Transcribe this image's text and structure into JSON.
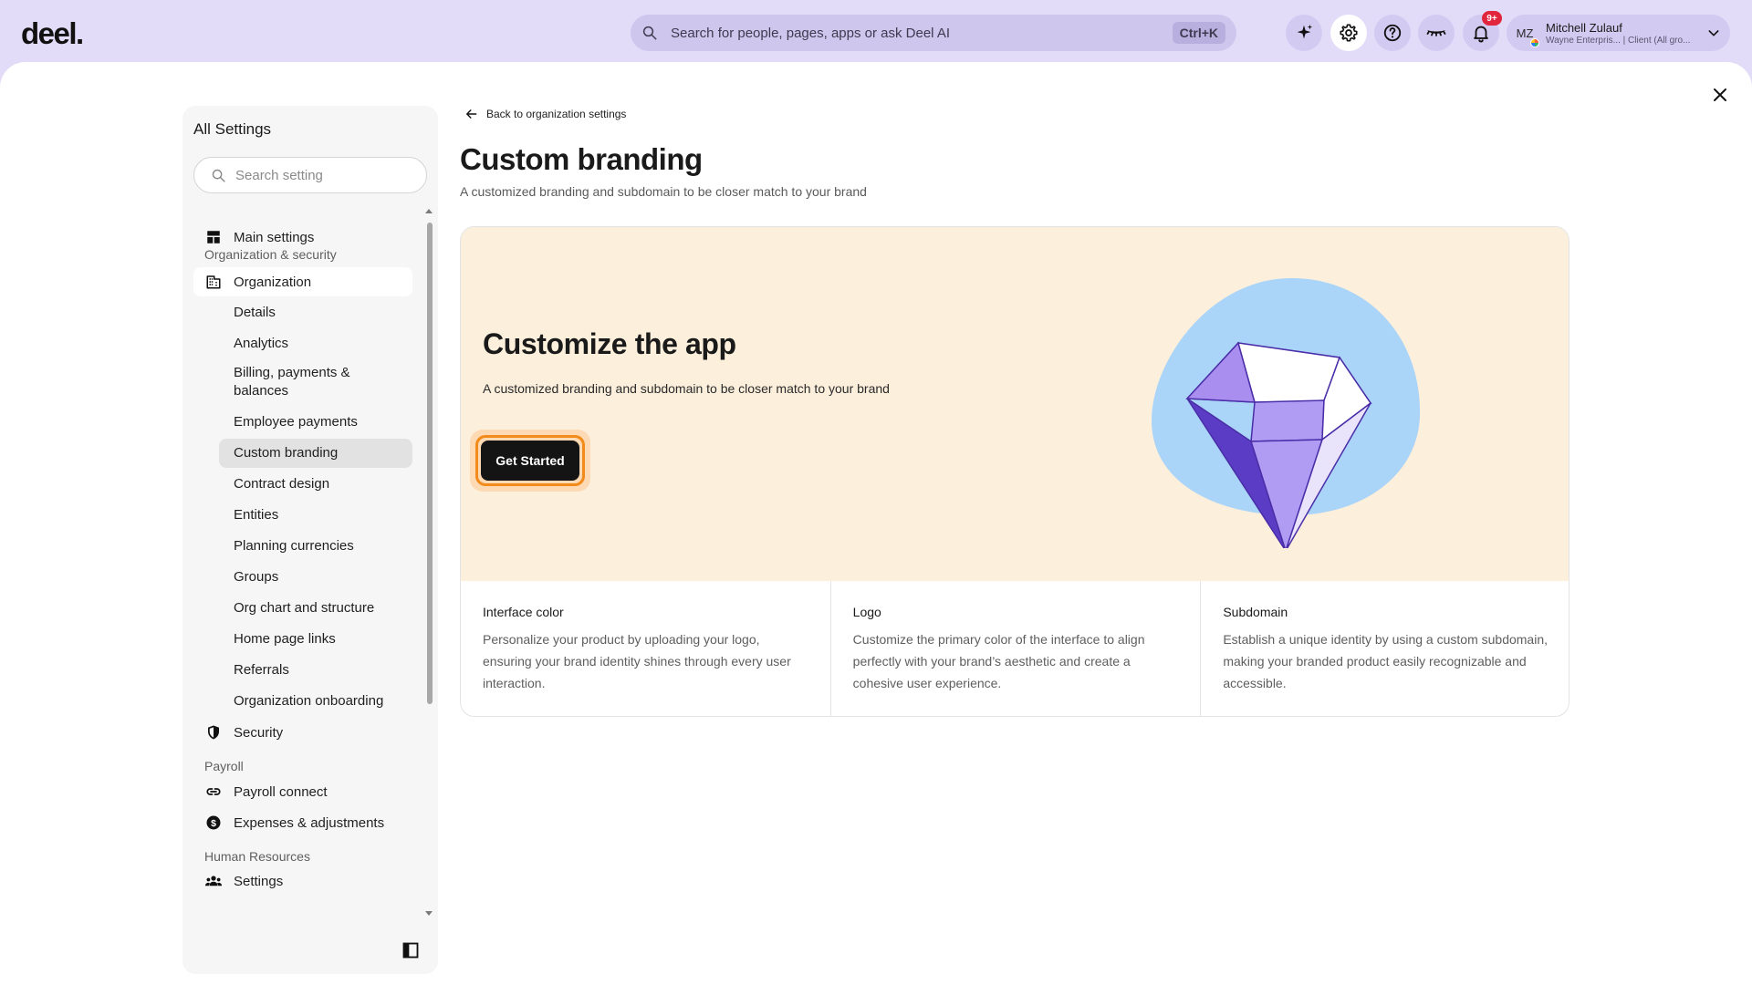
{
  "brand": {
    "logo": "deel."
  },
  "search": {
    "placeholder": "Search for people, pages, apps or ask Deel AI",
    "shortcut": "Ctrl+K"
  },
  "topbar_icons": [
    {
      "name": "ai-sparkle-icon"
    },
    {
      "name": "gear-icon"
    },
    {
      "name": "help-icon"
    },
    {
      "name": "closed-eye-icon"
    },
    {
      "name": "bell-icon"
    }
  ],
  "notifications": {
    "badge": "9+"
  },
  "user": {
    "initials": "MZ",
    "name": "Mitchell Zulauf",
    "subtitle": "Wayne Enterpris... | Client (All gro..."
  },
  "sidebar": {
    "title": "All Settings",
    "search_placeholder": "Search setting",
    "main_settings": "Main settings",
    "section_org": "Organization & security",
    "organization": "Organization",
    "org_items": [
      "Details",
      "Analytics",
      "Billing, payments & balances",
      "Employee payments",
      "Custom branding",
      "Contract design",
      "Entities",
      "Planning currencies",
      "Groups",
      "Org chart and structure",
      "Home page links",
      "Referrals",
      "Organization onboarding"
    ],
    "selected_item": "Custom branding",
    "security": "Security",
    "section_payroll": "Payroll",
    "payroll_connect": "Payroll connect",
    "expenses": "Expenses & adjustments",
    "section_hr": "Human Resources",
    "hr_settings": "Settings"
  },
  "content": {
    "back_link": "Back to organization settings",
    "title": "Custom branding",
    "subtitle": "A customized branding and subdomain to be closer match to your brand",
    "hero": {
      "title": "Customize the app",
      "subtitle": "A customized branding and subdomain to be closer match to your brand",
      "cta": "Get Started"
    },
    "features": [
      {
        "title": "Interface color",
        "desc": "Personalize your product by uploading your logo, ensuring your brand identity shines through every user interaction."
      },
      {
        "title": "Logo",
        "desc": "Customize the primary color of the interface to align perfectly with your brand’s aesthetic and create a cohesive user experience."
      },
      {
        "title": "Subdomain",
        "desc": "Establish a unique identity by using a custom subdomain, making your branded product easily recognizable and accessible."
      }
    ]
  },
  "colors": {
    "topbar": "#e3dcf8",
    "hero_bg": "#fcefdc",
    "accent_orange": "#f28b1a",
    "diamond_purple": "#b19cf4",
    "blob_blue": "#aad4f8"
  }
}
